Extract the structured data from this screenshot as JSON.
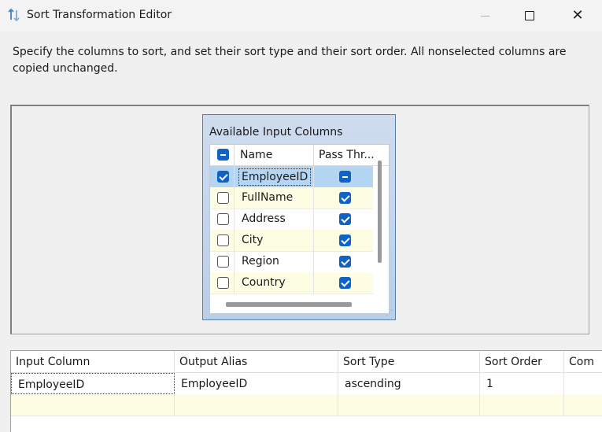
{
  "window": {
    "title": "Sort Transformation Editor",
    "close_glyph": "✕"
  },
  "description": "Specify the columns to sort, and set their sort type and their sort order. All nonselected columns are copied unchanged.",
  "available_columns": {
    "title": "Available Input Columns",
    "headers": {
      "name": "Name",
      "pass_through": "Pass Thr..."
    },
    "rows": [
      {
        "name": "EmployeeID",
        "selected": true,
        "pass_through": "partial"
      },
      {
        "name": "FullName",
        "selected": false,
        "pass_through": "checked"
      },
      {
        "name": "Address",
        "selected": false,
        "pass_through": "checked"
      },
      {
        "name": "City",
        "selected": false,
        "pass_through": "checked"
      },
      {
        "name": "Region",
        "selected": false,
        "pass_through": "checked"
      },
      {
        "name": "Country",
        "selected": false,
        "pass_through": "checked"
      }
    ]
  },
  "grid": {
    "headers": [
      "Input Column",
      "Output Alias",
      "Sort Type",
      "Sort Order",
      "Com"
    ],
    "rows": [
      [
        "EmployeeID",
        "EmployeeID",
        "ascending",
        "1",
        ""
      ],
      [
        "",
        "",
        "",
        "",
        ""
      ]
    ]
  },
  "colors": {
    "selected_row": "#b4d6f4",
    "alt_row": "#fdfde3",
    "checkbox_accent": "#0f63c5"
  }
}
